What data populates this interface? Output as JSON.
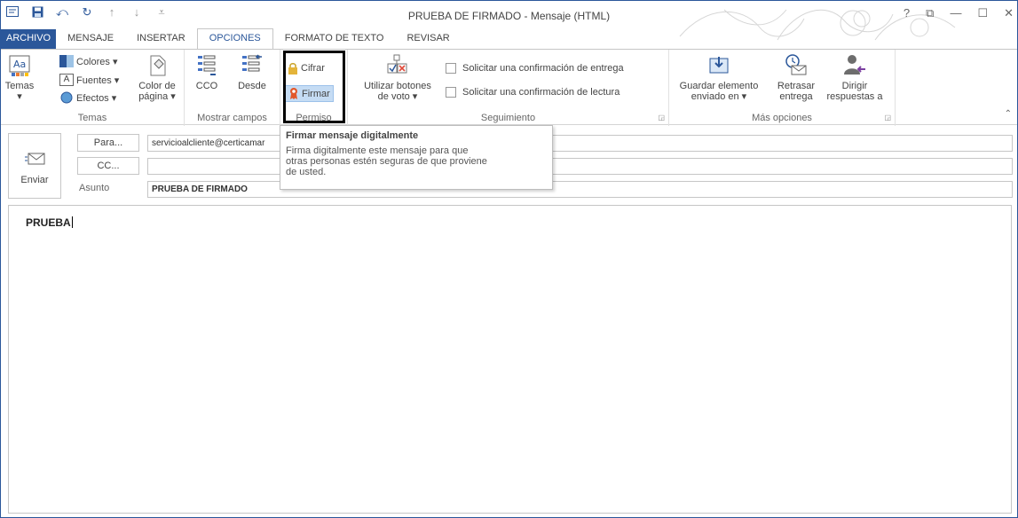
{
  "window": {
    "title": "PRUEBA DE FIRMADO - Mensaje (HTML)",
    "controls": [
      "?",
      "⧉",
      "—",
      "☐",
      "✕"
    ]
  },
  "quick_access": [
    "outlook-icon",
    "save-icon",
    "undo-icon",
    "redo-icon",
    "up-arrow-icon",
    "down-arrow-icon",
    "customize-icon"
  ],
  "tabs": [
    {
      "label": "ARCHIVO",
      "active": false
    },
    {
      "label": "MENSAJE",
      "active": false
    },
    {
      "label": "INSERTAR",
      "active": false
    },
    {
      "label": "OPCIONES",
      "active": true
    },
    {
      "label": "FORMATO DE TEXTO",
      "active": false
    },
    {
      "label": "REVISAR",
      "active": false
    }
  ],
  "ribbon": {
    "temas": {
      "label": "Temas",
      "temas_btn": "Temas",
      "colores": "Colores ▾",
      "fuentes": "Fuentes ▾",
      "efectos": "Efectos ▾",
      "color_pagina_1": "Color de",
      "color_pagina_2": "página ▾"
    },
    "mostrar": {
      "label": "Mostrar campos",
      "cco": "CCO",
      "desde": "Desde"
    },
    "permiso": {
      "label": "Permiso",
      "cifrar": "Cifrar",
      "firmar": "Firmar"
    },
    "seguimiento": {
      "label": "Seguimiento",
      "votar_1": "Utilizar botones",
      "votar_2": "de voto ▾",
      "confirm_entrega": "Solicitar una confirmación de entrega",
      "confirm_lectura": "Solicitar una confirmación de lectura"
    },
    "mas_opciones": {
      "label": "Más opciones",
      "guardar_1": "Guardar elemento",
      "guardar_2": "enviado en ▾",
      "retrasar_1": "Retrasar",
      "retrasar_2": "entrega",
      "dirigir_1": "Dirigir",
      "dirigir_2": "respuestas a"
    }
  },
  "tooltip": {
    "title": "Firmar mensaje digitalmente",
    "body_1": "Firma digitalmente este mensaje para que",
    "body_2": "otras personas estén seguras de que proviene",
    "body_3": "de usted."
  },
  "compose": {
    "send": "Enviar",
    "para_btn": "Para...",
    "cc_btn": "CC...",
    "asunto_label": "Asunto",
    "para_value": "servicioalcliente@certicamar",
    "cc_value": "",
    "asunto_value": "PRUEBA DE FIRMADO"
  },
  "body": {
    "text": "PRUEBA"
  },
  "colors": {
    "accent": "#2b579a",
    "highlight": "#c5dcf4"
  }
}
